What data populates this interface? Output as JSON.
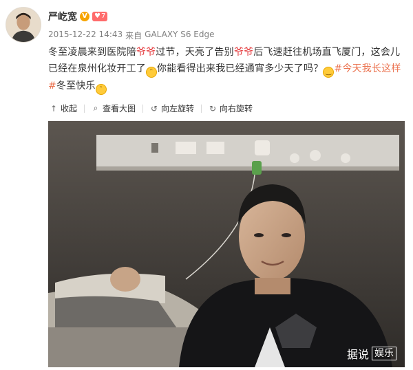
{
  "user": {
    "name": "严屹宽",
    "verified_badge": "V",
    "level_badge": "7"
  },
  "meta": {
    "timestamp": "2015-12-22 14:43",
    "source_prefix": "来自",
    "device": "GALAXY S6 Edge"
  },
  "post": {
    "seg1": "冬至凌晨来到医院陪",
    "hl1": "爷爷",
    "seg2": "过节，天亮了告别",
    "hl2": "爷爷",
    "seg3": "后飞速赶往机场直飞厦门，这会儿已经在泉州化妆开工了",
    "seg4": "你能看得出来我已经通宵多少天了吗？",
    "topic": "#今天我长这样#",
    "seg5": "冬至快乐"
  },
  "actions": {
    "collapse": "收起",
    "view_large": "查看大图",
    "rotate_left": "向左旋转",
    "rotate_right": "向右旋转"
  },
  "watermark": {
    "left": "据说",
    "right": "娱乐"
  },
  "icons": {
    "collapse": "arrow-up-icon",
    "view_large": "magnifier-icon",
    "rotate_left": "rotate-left-icon",
    "rotate_right": "rotate-right-icon"
  },
  "colors": {
    "highlight": "#e4393c",
    "topic": "#eb7350",
    "meta": "#808080"
  }
}
